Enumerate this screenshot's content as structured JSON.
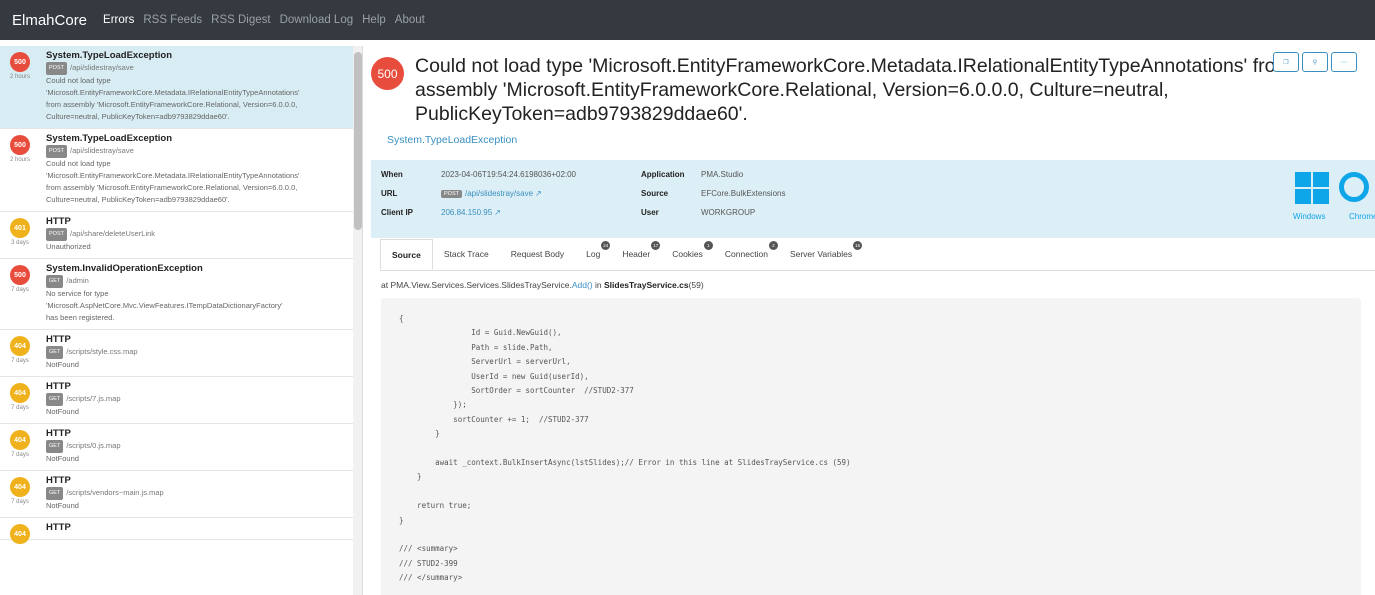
{
  "navbar": {
    "brand": "ElmahCore",
    "links": [
      {
        "label": "Errors"
      },
      {
        "label": "RSS Feeds"
      },
      {
        "label": "RSS Digest"
      },
      {
        "label": "Download Log"
      },
      {
        "label": "Help"
      },
      {
        "label": "About"
      }
    ]
  },
  "errors": [
    {
      "code": "500",
      "age": "2 hours",
      "type": "System.TypeLoadException",
      "method": "POST",
      "url": "/api/slidestray/save",
      "message": "Could not load type\n'Microsoft.EntityFrameworkCore.Metadata.IRelationalEntityTypeAnnotations'\nfrom assembly 'Microsoft.EntityFrameworkCore.Relational, Version=6.0.0.0,\nCulture=neutral, PublicKeyToken=adb9793829ddae60'."
    },
    {
      "code": "500",
      "age": "2 hours",
      "type": "System.TypeLoadException",
      "method": "POST",
      "url": "/api/slidestray/save",
      "message": "Could not load type\n'Microsoft.EntityFrameworkCore.Metadata.IRelationalEntityTypeAnnotations'\nfrom assembly 'Microsoft.EntityFrameworkCore.Relational, Version=6.0.0.0,\nCulture=neutral, PublicKeyToken=adb9793829ddae60'."
    },
    {
      "code": "401",
      "age": "3 days",
      "type": "HTTP",
      "method": "POST",
      "url": "/api/share/deleteUserLink",
      "message": "Unauthorized"
    },
    {
      "code": "500",
      "age": "7 days",
      "type": "System.InvalidOperationException",
      "method": "GET",
      "url": "/admin",
      "message": "No service for type\n'Microsoft.AspNetCore.Mvc.ViewFeatures.ITempDataDictionaryFactory'\nhas been registered."
    },
    {
      "code": "404",
      "age": "7 days",
      "type": "HTTP",
      "method": "GET",
      "url": "/scripts/style.css.map",
      "message": "NotFound"
    },
    {
      "code": "404",
      "age": "7 days",
      "type": "HTTP",
      "method": "GET",
      "url": "/scripts/7.js.map",
      "message": "NotFound"
    },
    {
      "code": "404",
      "age": "7 days",
      "type": "HTTP",
      "method": "GET",
      "url": "/scripts/0.js.map",
      "message": "NotFound"
    },
    {
      "code": "404",
      "age": "7 days",
      "type": "HTTP",
      "method": "GET",
      "url": "/scripts/vendors~main.js.map",
      "message": "NotFound"
    },
    {
      "code": "404",
      "age": "",
      "type": "HTTP",
      "method": "",
      "url": "",
      "message": ""
    }
  ],
  "detail": {
    "code": "500",
    "title": "Could not load type 'Microsoft.EntityFrameworkCore.Metadata.IRelationalEntityTypeAnnotations' from assembly 'Microsoft.EntityFrameworkCore.Relational, Version=6.0.0.0, Culture=neutral, PublicKeyToken=adb9793829ddae60'.",
    "type": "System.TypeLoadException",
    "when_label": "When",
    "when": "2023-04-06T19:54:24.6198036+02:00",
    "url_label": "URL",
    "url_method": "POST",
    "url": "/api/slidestray/save",
    "ip_label": "Client IP",
    "ip": "206.84.150.95",
    "app_label": "Application",
    "app": "PMA.Studio",
    "source_label": "Source",
    "source": "EFCore.BulkExtensions",
    "user_label": "User",
    "user": "WORKGROUP",
    "os": "Windows",
    "browser": "Chrome"
  },
  "tabs": [
    {
      "label": "Source",
      "count": ""
    },
    {
      "label": "Stack Trace",
      "count": ""
    },
    {
      "label": "Request Body",
      "count": ""
    },
    {
      "label": "Log",
      "count": "24"
    },
    {
      "label": "Header",
      "count": "17"
    },
    {
      "label": "Cookies",
      "count": "1"
    },
    {
      "label": "Connection",
      "count": "2"
    },
    {
      "label": "Server Variables",
      "count": "15"
    }
  ],
  "source": {
    "prefix": "at PMA.View.Services.Services.SlidesTrayService.",
    "method": "Add()",
    "mid": " in ",
    "file": "SlidesTrayService.cs",
    "line": "(59)"
  },
  "code_lines": [
    "{",
    "                Id = Guid.NewGuid(),",
    "                Path = slide.Path,",
    "                ServerUrl = serverUrl,",
    "                UserId = new Guid(userId),",
    "                SortOrder = sortCounter  //STUD2-377",
    "            });",
    "            sortCounter += 1;  //STUD2-377",
    "        }",
    "",
    "        await _context.BulkInsertAsync(lstSlides);// Error in this line at SlidesTrayService.cs (59)",
    "    }",
    "",
    "    return true;",
    "}",
    "",
    "/// <summary>",
    "/// STUD2-399",
    "/// </summary>"
  ],
  "colors": {
    "error_500": "#e74c3c",
    "warning_4xx": "#f0b21c",
    "link": "#3a8fc0",
    "info_bg": "#ddeff6",
    "selected": "#d7ecf3"
  }
}
